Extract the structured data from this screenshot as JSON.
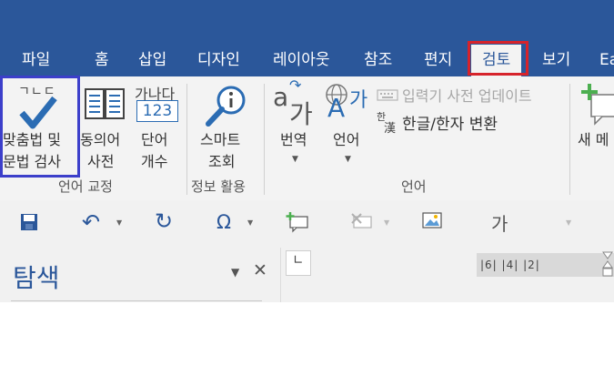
{
  "tabs": [
    "파일",
    "홈",
    "삽입",
    "디자인",
    "레이아웃",
    "참조",
    "편지",
    "검토",
    "보기",
    "Ea"
  ],
  "ribbon": {
    "spelling": {
      "icon_text": "ㄱㄴㄷ",
      "label1": "맞춤법 및",
      "label2": "문법 검사"
    },
    "thesaurus": {
      "label1": "동의어",
      "label2": "사전"
    },
    "wordcount": {
      "icon_top": "가나다",
      "icon_num": "123",
      "label1": "단어",
      "label2": "개수"
    },
    "smart_lookup": {
      "label1": "스마트",
      "label2": "조회"
    },
    "translate": {
      "icon_a": "a",
      "icon_ga": "가",
      "label": "번역"
    },
    "language": {
      "icon_a": "A",
      "icon_ga": "가",
      "label": "언어"
    },
    "ime_update": {
      "label": "입력기 사전 업데이트"
    },
    "hanja": {
      "icon_han": "한",
      "icon_hanja": "漢",
      "label": "한글/한자 변환"
    },
    "new_comment": {
      "label": "새 메"
    },
    "groups": {
      "proofing": "언어 교정",
      "insights": "정보 활용",
      "language": "언어"
    }
  },
  "qat": {
    "omega": "Ω",
    "ga": "가"
  },
  "nav": {
    "title": "탐색",
    "close": "✕",
    "dropdown": "▼"
  },
  "ruler": {
    "text": "|6|  |4|  |2|"
  },
  "colors": {
    "title_bar": "#2b579a",
    "active_tab_outline": "#d6232b",
    "spelling_outline": "#3c3fca"
  }
}
